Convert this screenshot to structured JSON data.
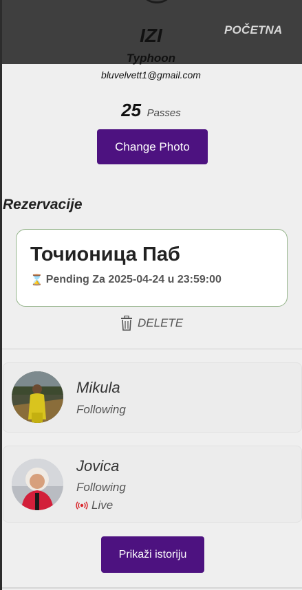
{
  "header": {
    "nav_link": "POČETNA"
  },
  "profile": {
    "app_title": "IZI",
    "username": "Typhoon",
    "email": "bluvelvett1@gmail.com",
    "passes_count": "25",
    "passes_label": "Passes",
    "change_photo_label": "Change Photo"
  },
  "reservations": {
    "title": "Rezervacije",
    "items": [
      {
        "venue": "Точионица Паб",
        "status": "Pending Za 2025-04-24 u 23:59:00",
        "status_icon": "hourglass-icon"
      }
    ],
    "delete_label": "DELETE"
  },
  "following": [
    {
      "name": "Mikula",
      "status": "Following"
    },
    {
      "name": "Jovica",
      "status": "Following",
      "live": "Live"
    }
  ],
  "history_button": "Prikaži istoriju",
  "colors": {
    "header_bg": "#3f3f3f",
    "accent_purple": "#4d1280",
    "card_border": "#93b389",
    "pending_icon": "#e8a11c",
    "live_icon": "#d9262b"
  }
}
